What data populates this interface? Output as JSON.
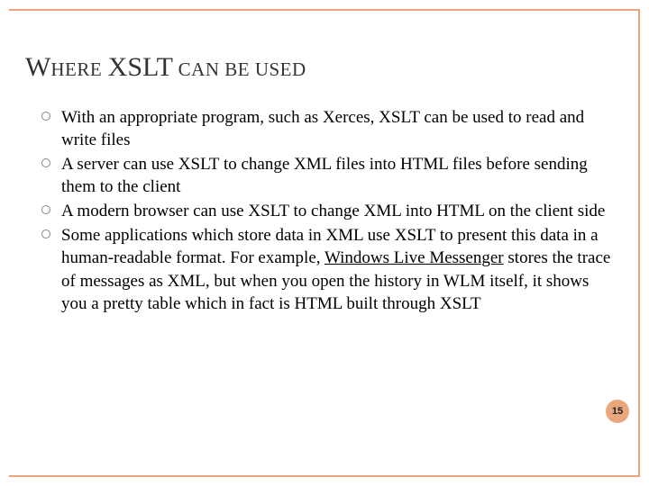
{
  "title": {
    "w_cap": "W",
    "w_rest": "HERE",
    "x_cap": "XSLT",
    "can_be_used": " CAN BE USED"
  },
  "bullets": [
    {
      "text": "With an appropriate program, such as Xerces, XSLT can be used to read and write files"
    },
    {
      "text": "A server can use XSLT to change XML files into HTML files before sending them to the client"
    },
    {
      "text": "A modern browser can use XSLT to change XML into HTML on the client side"
    },
    {
      "pre": "Some applications which store data in XML use XSLT to present this data in a human-readable format. For example, ",
      "link": "Windows Live Messenger",
      "post": " stores the trace of messages as XML, but when you open the history in WLM itself, it shows you a pretty table which in fact is HTML built through XSLT"
    }
  ],
  "page_number": "15",
  "colors": {
    "accent": "#e8a87c"
  }
}
